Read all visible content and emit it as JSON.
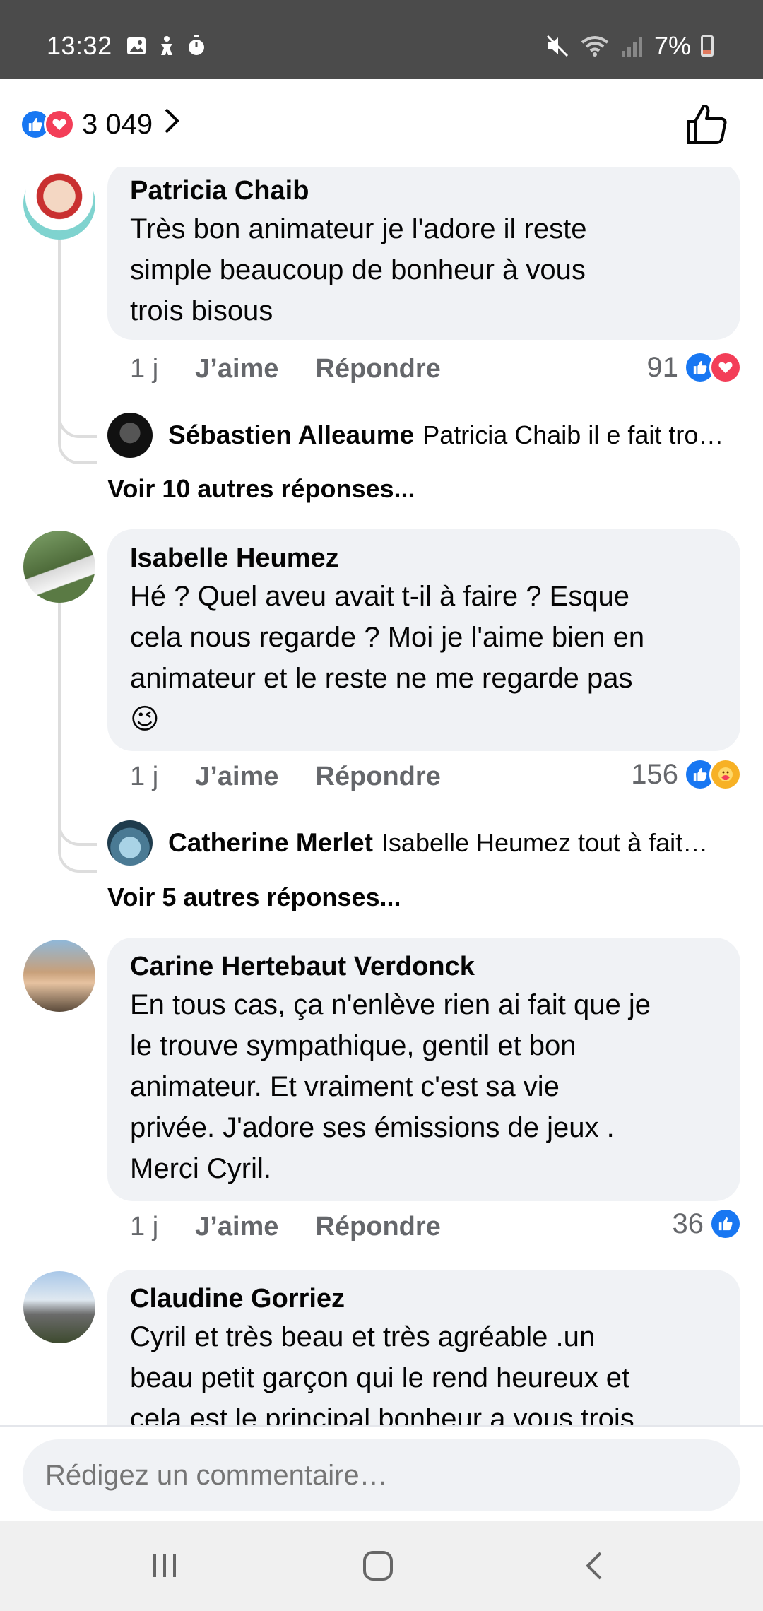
{
  "status_bar": {
    "time": "13:32",
    "battery": "7%",
    "left_icons": [
      "image-icon",
      "accessibility-icon",
      "timer-icon"
    ],
    "right_icons": [
      "mute-icon",
      "wifi-icon",
      "signal-icon",
      "battery-icon"
    ]
  },
  "header": {
    "reaction_count": "3 049",
    "reactions": [
      "like",
      "love"
    ]
  },
  "comments": [
    {
      "author": "Patricia Chaib",
      "lines": [
        "Très bon animateur je l'adore il reste",
        "simple beaucoup de bonheur à vous",
        "trois bisous"
      ],
      "time": "1 j",
      "like_label": "J’aime",
      "reply_label": "Répondre",
      "reactions_count": "91",
      "reply_preview": {
        "author": "Sébastien Alleaume",
        "text": "Patricia Chaib il e fait tro…"
      },
      "more_replies": "Voir 10 autres réponses..."
    },
    {
      "author": "Isabelle Heumez",
      "lines": [
        "Hé ? Quel aveu avait t-il à faire ? Esque",
        "cela nous regarde ? Moi je l'aime bien en",
        "animateur et le reste ne me regarde pas"
      ],
      "emoji": "😉",
      "time": "1 j",
      "like_label": "J’aime",
      "reply_label": "Répondre",
      "reactions_count": "156",
      "reply_preview": {
        "author": "Catherine Merlet",
        "text": "Isabelle Heumez tout à fait…"
      },
      "more_replies": "Voir 5 autres réponses..."
    },
    {
      "author": "Carine Hertebaut Verdonck",
      "lines": [
        "En tous cas, ça n'enlève rien ai fait que je",
        "le trouve sympathique,  gentil et bon",
        "animateur. Et vraiment c'est sa vie",
        "privée.  J'adore ses émissions de jeux .",
        "Merci Cyril."
      ],
      "time": "1 j",
      "like_label": "J’aime",
      "reply_label": "Répondre",
      "reactions_count": "36"
    },
    {
      "author": "Claudine Gorriez",
      "lines": [
        "Cyril et très beau et très agréable .un",
        "beau petit garçon qui le rend heureux et",
        "cela est le principal bonheur a vous trois"
      ]
    }
  ],
  "composer": {
    "placeholder": "Rédigez un commentaire…"
  },
  "colors": {
    "like_blue": "#1877f2",
    "love_red": "#f33e58",
    "care_yellow": "#f7b125",
    "bubble_bg": "#f0f2f5",
    "meta_gray": "#65676b"
  }
}
